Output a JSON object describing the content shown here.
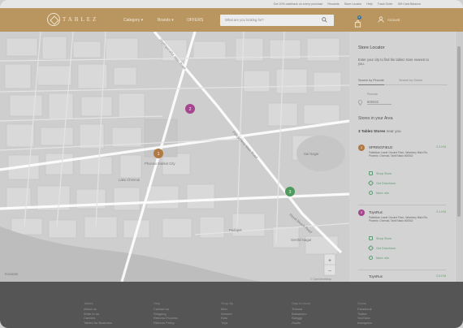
{
  "topbar": {
    "items": [
      "Get 10% cashback on every purchase",
      "Rewards",
      "Store Locator",
      "Help",
      "Track Order",
      "Gift Card Balance"
    ]
  },
  "header": {
    "logo_text": "TABLEZ",
    "nav": [
      "Category",
      "Brands",
      "OFFERS"
    ],
    "search_placeholder": "What are you looking for?",
    "cart_count": "0",
    "account_label": "Account"
  },
  "map": {
    "road_labels": [
      "Sholinganallur Main Road",
      "Pudupet",
      "Royal Beach Road",
      "Senthil Nagar"
    ],
    "place_labels": [
      "Phoenix Market City",
      "Lake Chennai",
      "Pondicherry Main Road",
      "Sai Nagar",
      "Kovalam"
    ],
    "markers": [
      {
        "label": "1",
        "color": "#b07a45"
      },
      {
        "label": "2",
        "color": "#a6468f"
      },
      {
        "label": "3",
        "color": "#4f9a5d"
      }
    ],
    "zoom_in": "+",
    "zoom_out": "−",
    "attribution": "© OpenStreetMap"
  },
  "panel": {
    "title": "Store Locator",
    "subtitle": "Enter your city to find the tablez store nearest to you.",
    "tabs": [
      "Search by Pincode",
      "Search by Stores"
    ],
    "pincode_label": "Pincode",
    "pincode_value": "600042",
    "stores_heading": "Stores in your Area",
    "stores_count_strong": "3 Tablez Stores",
    "stores_count_rest": "near you",
    "stores": [
      {
        "num": "1",
        "color": "#b07a45",
        "name": "SPRINGFIELD",
        "distance": "2.3 KM",
        "address": "Palladium Lower Ground Floor, Velachery Main Rd, Phoenix, Chennai, Tamil Nadu 600042",
        "actions": [
          "Shop Store",
          "Get Directions",
          "More Info"
        ]
      },
      {
        "num": "2",
        "color": "#a6468f",
        "name": "ToysRus",
        "distance": "2.4 KM",
        "address": "Palladium Lower Ground Floor, Velachery Main Rd, Phoenix, Chennai, Tamil Nadu 600042",
        "actions": [
          "Shop Store",
          "Get Directions",
          "More Info"
        ]
      },
      {
        "num": "3",
        "color": "#4f9a5d",
        "name": "ToysRus",
        "distance": "2.6 KM"
      }
    ]
  },
  "footer": {
    "columns": [
      {
        "heading": "Tablez",
        "links": [
          "About us",
          "Write to us",
          "Careers",
          "Tablez for Business"
        ]
      },
      {
        "heading": "Help",
        "links": [
          "Contact us",
          "Shipping",
          "Returns Process",
          "Returns Policy"
        ]
      },
      {
        "heading": "Shop By",
        "links": [
          "Men",
          "Women",
          "Kids",
          "Toys"
        ]
      },
      {
        "heading": "Stay in touch",
        "links": [
          "Trizana",
          "Balsamico",
          "Swiggy",
          "Zeptio"
        ]
      },
      {
        "heading": "Social",
        "links": [
          "Facebook",
          "Twitter",
          "YouTube",
          "Instagram"
        ]
      }
    ]
  }
}
